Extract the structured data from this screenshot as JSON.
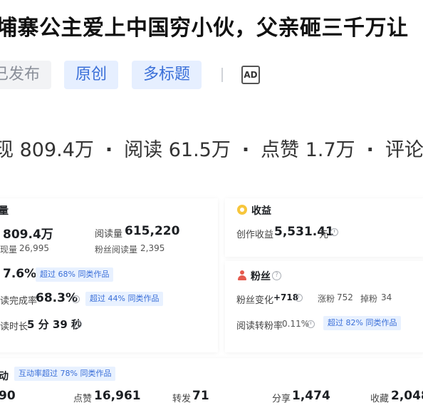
{
  "article": {
    "title": "埔寨公主爱上中国穷小伙，父亲砸三千万让",
    "tags": {
      "published": "已发布",
      "original": "原创",
      "multi_title": "多标题"
    },
    "ad_label": "AD",
    "summary": {
      "impressions": "现 809.4万",
      "reads": "阅读 61.5万",
      "likes": "点赞 1.7万",
      "comments": "评论"
    }
  },
  "traffic": {
    "heading": "量",
    "impressions_value": "809.4万",
    "reads_label": "阅读量",
    "reads_value": "615,220",
    "fans_impressions_label": "现量",
    "fans_impressions_value": "26,995",
    "fans_reads_label": "粉丝阅读量",
    "fans_reads_value": "2,395",
    "ctr_value": "7.6%",
    "ctr_badge": "超过 68% 同类作品",
    "completion_label": "读完成率",
    "completion_value": "68.3%",
    "completion_badge": "超过 44% 同类作品",
    "duration_label": "读时长",
    "duration_value": "5 分 39 秒"
  },
  "income": {
    "heading": "收益",
    "label": "创作收益",
    "value": "5,531.41",
    "unit": "元"
  },
  "fans": {
    "heading": "粉丝",
    "change_label": "粉丝变化",
    "change_value": "+718",
    "gain_label": "涨粉",
    "gain_value": "752",
    "loss_label": "掉粉",
    "loss_value": "34",
    "conv_label": "阅读转粉率",
    "conv_value": "0.11%",
    "conv_badge": "超过 82% 同类作品"
  },
  "interaction": {
    "heading": "动",
    "badge": "互动率超过 78% 同类作品",
    "comments_value": "90",
    "likes_label": "点赞",
    "likes_value": "16,961",
    "forwards_label": "转发",
    "forwards_value": "71",
    "shares_label": "分享",
    "shares_value": "1,474",
    "favorites_label": "收藏",
    "favorites_value": "2,048"
  },
  "colors": {
    "accent_blue": "#3a6fd8",
    "badge_bg": "#e8f1ff",
    "coin": "#f7c63c",
    "fans_icon": "#e55a4e"
  }
}
